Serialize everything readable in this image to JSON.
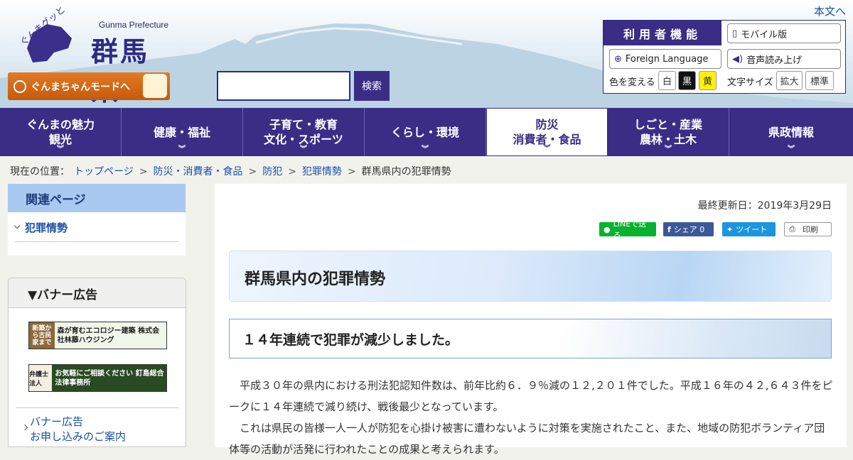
{
  "header": {
    "skip_link": "本文へ",
    "logo_en": "Gunma Prefecture",
    "logo_title": "群馬県",
    "logo_kana": "ぐんまグッと",
    "gunma_mode_label": "ぐんまちゃんモードへ",
    "search_placeholder": "",
    "search_button": "検索"
  },
  "utility": {
    "title": "利用者機能",
    "mobile": "モバイル版",
    "foreign": "Foreign Language",
    "voice": "音声読み上げ",
    "color_label": "色を変える",
    "color_white": "白",
    "color_black": "黒",
    "color_yellow": "黄",
    "size_label": "文字サイズ",
    "size_large": "拡大",
    "size_normal": "標準"
  },
  "nav": {
    "items": [
      {
        "line1": "ぐんまの魅力",
        "line2": "観光"
      },
      {
        "line1": "健康・福祉",
        "line2": ""
      },
      {
        "line1": "子育て・教育",
        "line2": "文化・スポーツ"
      },
      {
        "line1": "くらし・環境",
        "line2": ""
      },
      {
        "line1": "防災",
        "line2": "消費者・食品"
      },
      {
        "line1": "しごと・産業",
        "line2": "農林・土木"
      },
      {
        "line1": "県政情報",
        "line2": ""
      }
    ]
  },
  "breadcrumb": {
    "prefix": "現在の位置：",
    "items": [
      "トップページ",
      "防災・消費者・食品",
      "防犯",
      "犯罪情勢"
    ],
    "current": "群馬県内の犯罪情勢"
  },
  "sidebar": {
    "related_title": "関連ページ",
    "related_link": "犯罪情勢",
    "banner_title": "▼バナー広告",
    "banner1": "森が育むエコロジー建築 株式会社林藤ハウジング",
    "banner1_left": "新築から古民家まで",
    "banner2": "お気軽にご相談ください 釘島総合法律事務所",
    "banner2_left": "弁護士法人",
    "banner_link_line1": "バナー広告",
    "banner_link_line2": "お申し込みのご案内"
  },
  "main": {
    "updated": "最終更新日：2019年3月29日",
    "share_line": "LINEで送る",
    "share_fb": "シェア 0",
    "share_tw": "ツイート",
    "print": "印刷",
    "title": "群馬県内の犯罪情勢",
    "subtitle": "１４年連続で犯罪が減少しました。",
    "para1": "平成３０年の県内における刑法犯認知件数は、前年比約６．９％減の１２,２０１件でした。平成１６年の４２,６４３件をピークに１４年連続で減り続け、戦後最少となっています。",
    "para2": "これは県民の皆様一人一人が防犯を心掛け被害に遭わないように対策を実施されたこと、また、地域の防犯ボランティア団体等の活動が活発に行われたことの成果と考えられます。"
  }
}
